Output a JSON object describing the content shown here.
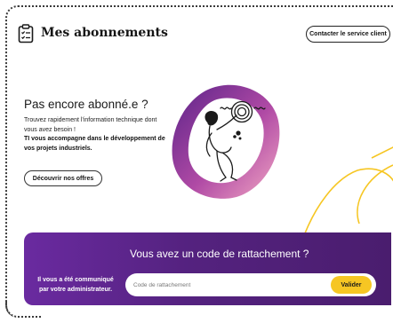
{
  "header": {
    "title": "Mes abonnements",
    "contact_label": "Contacter le service client",
    "icon": "clipboard-list-icon"
  },
  "promo": {
    "headline": "Pas encore abonné.e ?",
    "description_line1": "Trouvez rapidement l'information technique dont vous avez besoin !",
    "description_line2": "TI vous accompagne dans le développement de vos projets industriels.",
    "offers_label": "Découvrir nos offres"
  },
  "banner": {
    "title": "Vous avez un code de rattachement ?",
    "note": "Il vous a été communiqué par votre administrateur.",
    "input_placeholder": "Code de rattachement",
    "input_value": "",
    "validate_label": "Valider"
  },
  "colors": {
    "purple": "#5b2389",
    "yellow": "#f6c623",
    "pink": "#e28ab4"
  }
}
